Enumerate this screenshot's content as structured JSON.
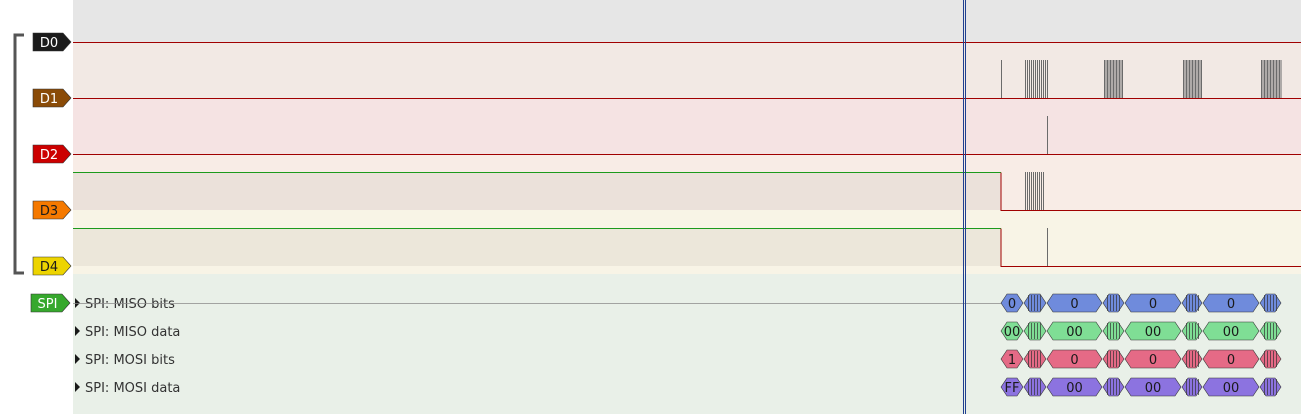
{
  "channels": [
    {
      "id": "d0",
      "label": "D0",
      "color": "#1b1b1b",
      "text_color": "#ffffff",
      "bg": "#e6e6e6"
    },
    {
      "id": "d1",
      "label": "D1",
      "color": "#8a4b07",
      "text_color": "#ffffff",
      "bg": "#f2e9e4"
    },
    {
      "id": "d2",
      "label": "D2",
      "color": "#cc0000",
      "text_color": "#ffffff",
      "bg": "#f5e3e3"
    },
    {
      "id": "d3",
      "label": "D3",
      "color": "#f57900",
      "text_color": "#1b1b1b",
      "bg": "#f8ece6"
    },
    {
      "id": "d4",
      "label": "D4",
      "color": "#edd400",
      "text_color": "#1b1b1b",
      "bg": "#f8f4e6"
    }
  ],
  "decoder": {
    "label": "SPI",
    "color": "#36a82d",
    "bg": "#e9f0e8",
    "rows": [
      {
        "id": "miso-bits",
        "label": "SPI: MISO bits",
        "color": "#6f8bdc",
        "values": [
          "0",
          "0",
          "0",
          "0"
        ]
      },
      {
        "id": "miso-data",
        "label": "SPI: MISO data",
        "color": "#7fde95",
        "values": [
          "00",
          "00",
          "00",
          "00"
        ]
      },
      {
        "id": "mosi-bits",
        "label": "SPI: MOSI bits",
        "color": "#e56a86",
        "values": [
          "1",
          "0",
          "0",
          "0"
        ]
      },
      {
        "id": "mosi-data",
        "label": "SPI: MOSI data",
        "color": "#8c73e0",
        "values": [
          "FF",
          "00",
          "00",
          "00"
        ]
      }
    ]
  },
  "colors": {
    "low_line": "#a00000",
    "high_line": "#1c9a1c",
    "cursor": "#1f3f8f",
    "group_bracket": "#555555",
    "ruler_bg": "#e6e6e6"
  }
}
